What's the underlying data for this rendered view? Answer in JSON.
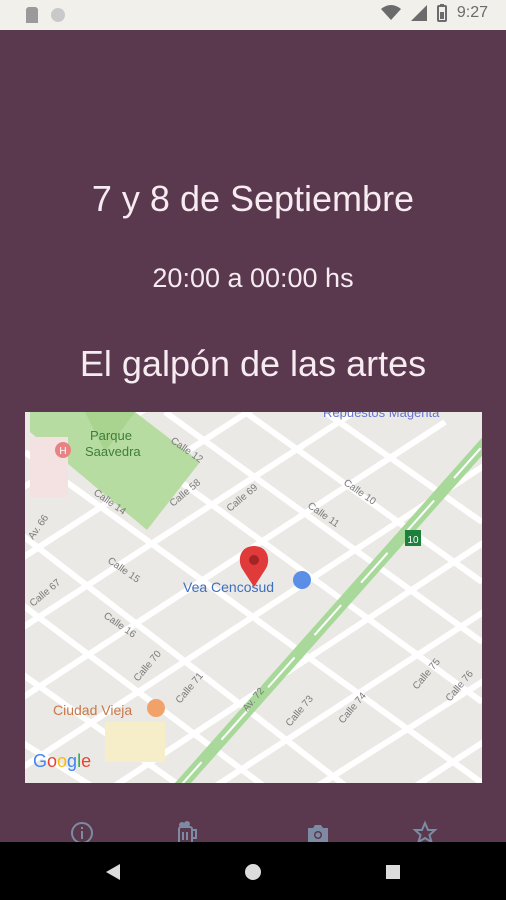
{
  "status_bar": {
    "time": "9:27"
  },
  "event": {
    "date": "7 y 8 de Septiembre",
    "time": "20:00 a 00:00 hs",
    "venue": "El galpón de las artes"
  },
  "map": {
    "labels": {
      "park": "Parque\nSaavedra",
      "repuestos": "Repuestos Magenta",
      "vea": "Vea Cencosud",
      "ciudad_vieja": "Ciudad Vieja",
      "route_badge": "10",
      "google_logo": "Google"
    },
    "streets": [
      "Calle 12",
      "Calle 58",
      "Calle 69",
      "Calle 10",
      "Calle 14",
      "Av. 66",
      "Calle 11",
      "Calle 15",
      "Calle 67",
      "Calle 16",
      "Calle 70",
      "Calle 71",
      "Av. 72",
      "Calle 73",
      "Calle 74",
      "Calle 75",
      "Calle 76"
    ]
  },
  "bottom_nav": [
    {
      "name": "info-icon"
    },
    {
      "name": "beer-icon"
    },
    {
      "name": "camera-icon"
    },
    {
      "name": "star-icon"
    }
  ],
  "colors": {
    "background": "#5a394f",
    "text": "#f6ebf1",
    "icon": "#7d8aa3"
  }
}
